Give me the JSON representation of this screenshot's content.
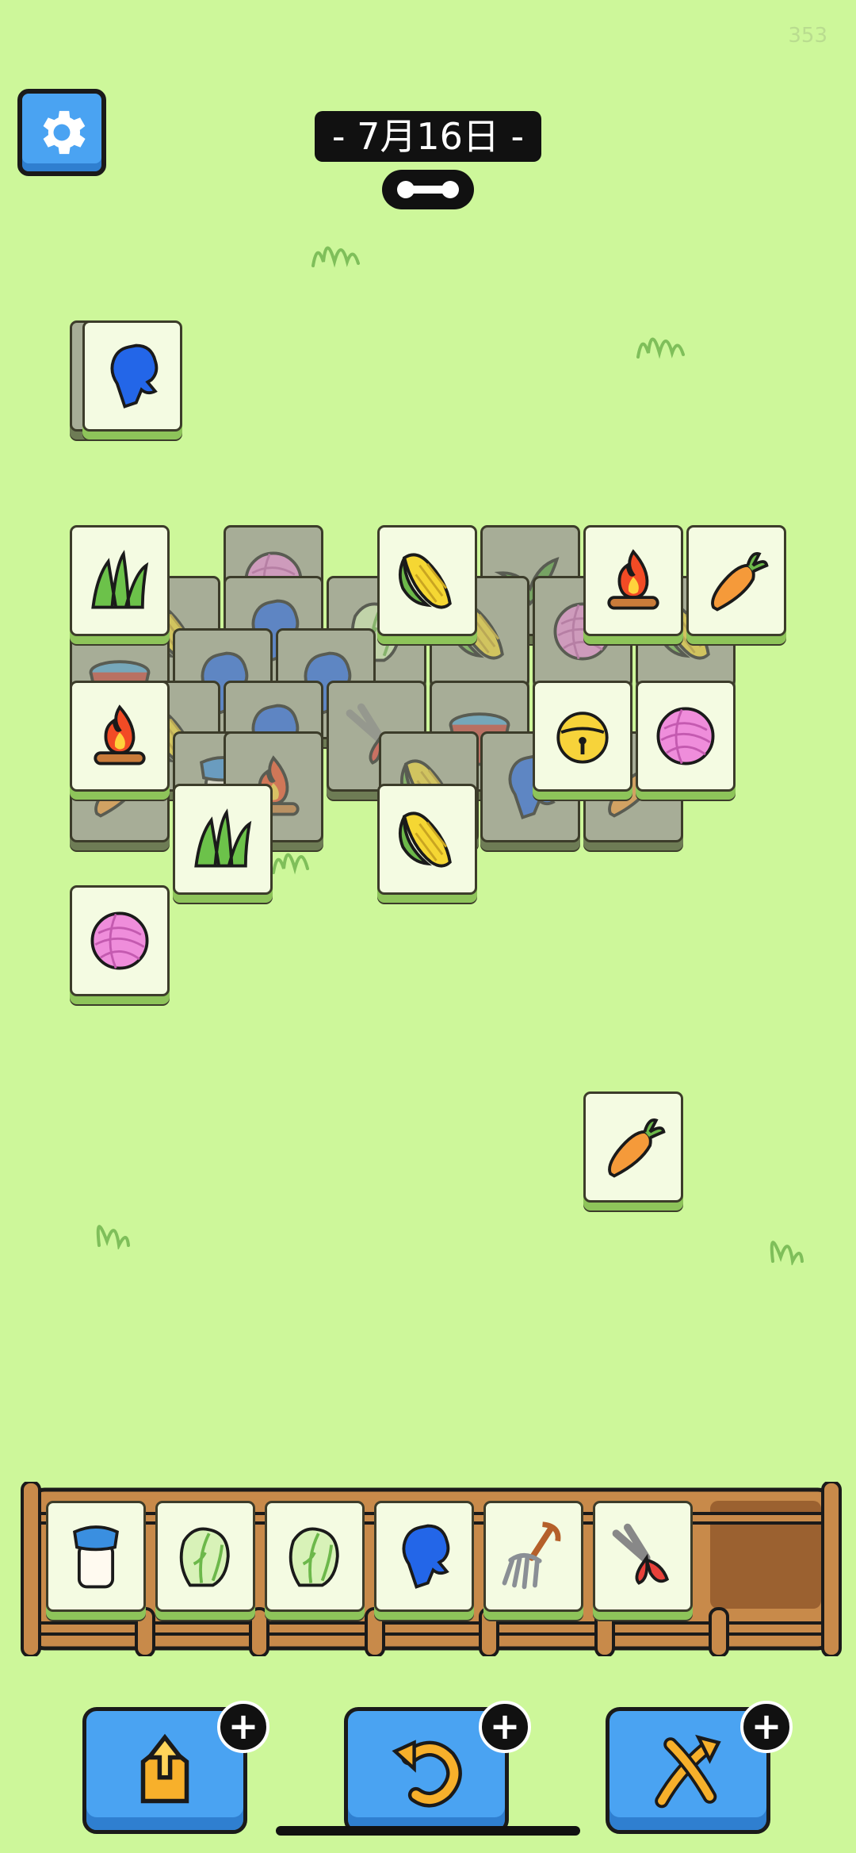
{
  "top": {
    "counter": "353",
    "date": "- 7月16日 -"
  },
  "board": {
    "tiles": [
      {
        "id": "glove-single",
        "icon": "glove-icon",
        "state": "active"
      },
      {
        "id": "grass-1",
        "icon": "grass-icon",
        "state": "active"
      },
      {
        "id": "yarn-back",
        "icon": "yarn-icon",
        "state": "covered"
      },
      {
        "id": "corn-top",
        "icon": "corn-icon",
        "state": "active"
      },
      {
        "id": "plant-back",
        "icon": "plant-icon",
        "state": "covered"
      },
      {
        "id": "campfire-1",
        "icon": "campfire-icon",
        "state": "active"
      },
      {
        "id": "carrot-1",
        "icon": "carrot-icon",
        "state": "active"
      },
      {
        "id": "campfire-2",
        "icon": "campfire-icon",
        "state": "active"
      },
      {
        "id": "shears-back",
        "icon": "shears-icon",
        "state": "covered"
      },
      {
        "id": "bucket-back",
        "icon": "bucket-icon",
        "state": "covered"
      },
      {
        "id": "bell-1",
        "icon": "bell-icon",
        "state": "active"
      },
      {
        "id": "yarn-1",
        "icon": "yarn-icon",
        "state": "active"
      },
      {
        "id": "grass-2",
        "icon": "grass-icon",
        "state": "active"
      },
      {
        "id": "corn-2",
        "icon": "corn-icon",
        "state": "active"
      },
      {
        "id": "yarn-2",
        "icon": "yarn-icon",
        "state": "active"
      },
      {
        "id": "carrot-2",
        "icon": "carrot-icon",
        "state": "active"
      }
    ]
  },
  "dock": {
    "slots": [
      {
        "icon": "milk-jar-icon"
      },
      {
        "icon": "cabbage-icon"
      },
      {
        "icon": "cabbage-icon"
      },
      {
        "icon": "glove-icon"
      },
      {
        "icon": "pitchfork-icon"
      },
      {
        "icon": "shears-icon"
      },
      {
        "icon": "empty"
      }
    ]
  },
  "actions": [
    {
      "name": "move-out",
      "icon": "move-out-icon",
      "plus": "+"
    },
    {
      "name": "undo",
      "icon": "undo-icon",
      "plus": "+"
    },
    {
      "name": "shuffle",
      "icon": "shuffle-icon",
      "plus": "+"
    }
  ],
  "colors": {
    "background": "#cdf79a",
    "button": "#4aa3f2",
    "tile": "#f4fbe2"
  }
}
